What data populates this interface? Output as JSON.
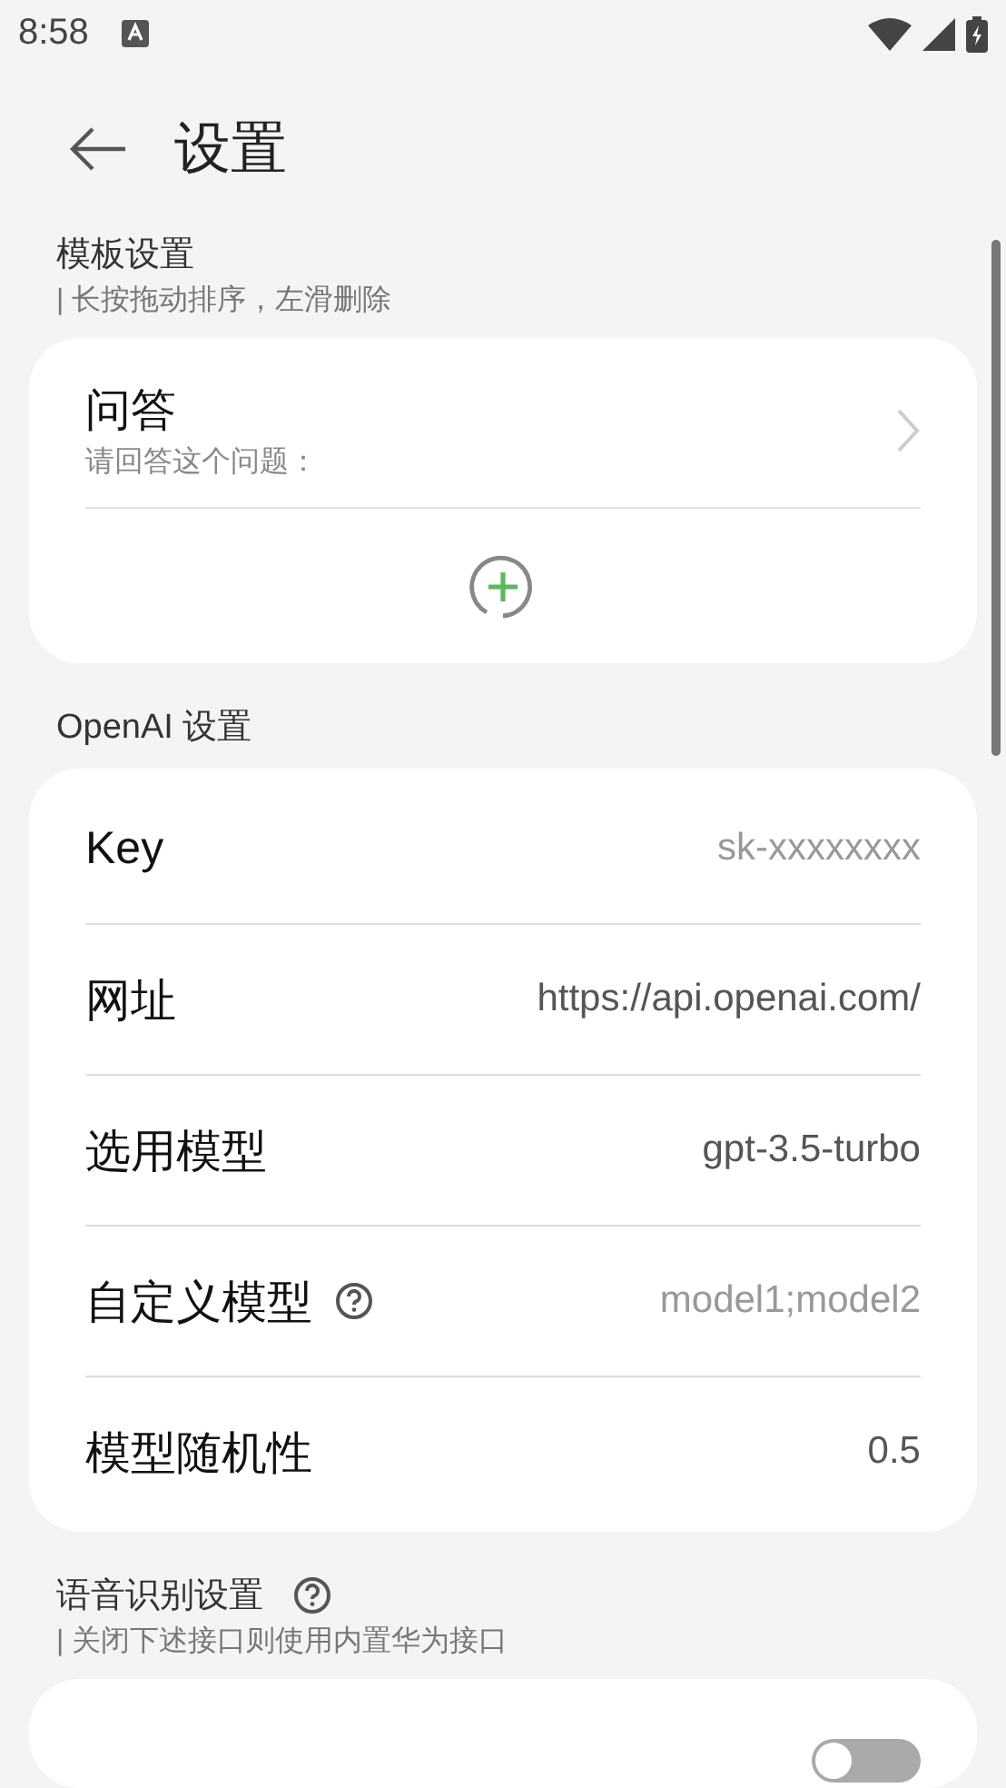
{
  "status_bar": {
    "time": "8:58"
  },
  "header": {
    "title": "设置"
  },
  "sections": [
    {
      "title": "模板设置",
      "help": false,
      "subtitle": "| 长按拖动排序，左滑删除",
      "card": {
        "kind": "templates",
        "items": [
          {
            "title": "问答",
            "prompt": "请回答这个问题："
          }
        ]
      }
    },
    {
      "title": "OpenAI 设置",
      "help": false,
      "card": {
        "kind": "fields",
        "rows": [
          {
            "label": "Key",
            "placeholder": "sk-xxxxxxxx",
            "help": false
          },
          {
            "label": "网址",
            "value": "https://api.openai.com/",
            "help": false
          },
          {
            "label": "选用模型",
            "value": "gpt-3.5-turbo",
            "help": false
          },
          {
            "label": "自定义模型",
            "placeholder": "model1;model2",
            "help": true
          },
          {
            "label": "模型随机性",
            "value": "0.5",
            "help": false
          }
        ]
      }
    },
    {
      "title": "语音识别设置",
      "help": true,
      "subtitle": "| 关闭下述接口则使用内置华为接口",
      "card": {
        "kind": "toggles",
        "rows": [
          {
            "on": false
          }
        ]
      }
    }
  ]
}
